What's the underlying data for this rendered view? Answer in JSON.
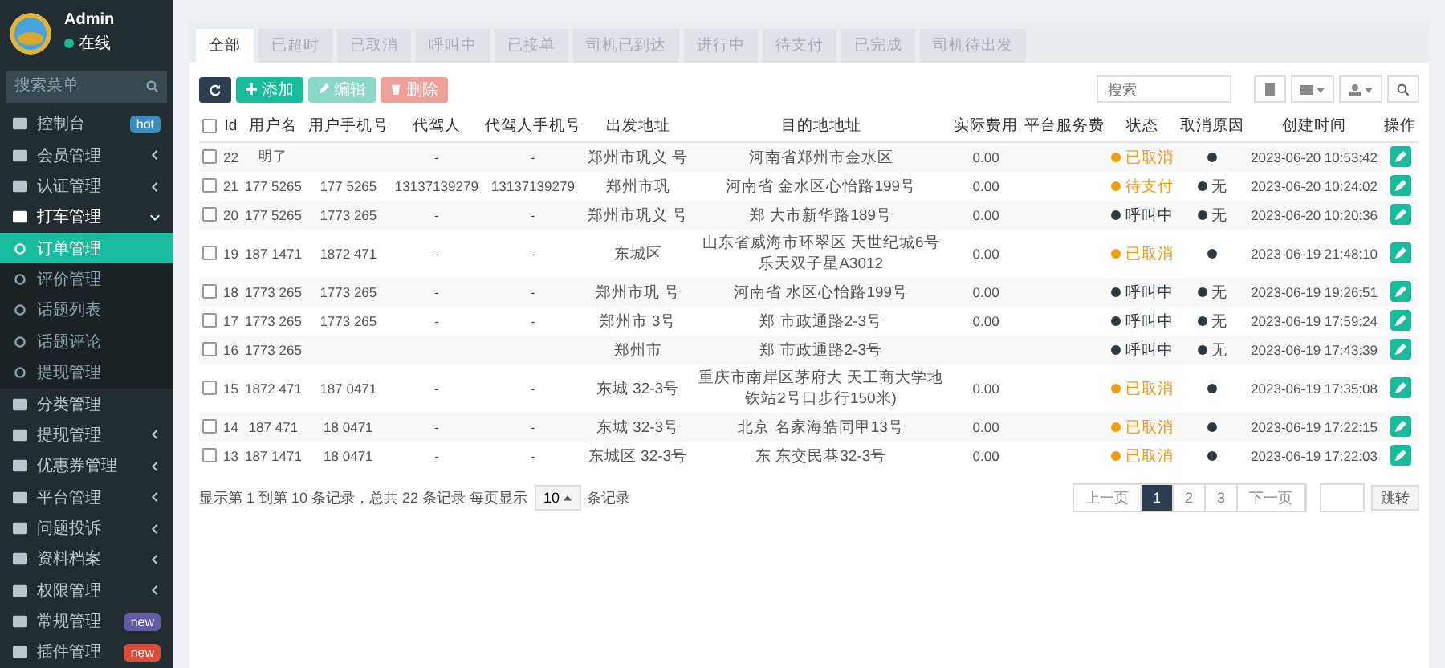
{
  "user": {
    "name": "Admin",
    "status": "在线"
  },
  "menu_search": {
    "placeholder": "搜索菜单"
  },
  "sidebar": {
    "items": [
      {
        "label": "控制台",
        "badge": {
          "text": "hot",
          "color": "#3c8dbc"
        },
        "selected": false
      },
      {
        "label": "会员管理",
        "expanded": false,
        "selected": false
      },
      {
        "label": "认证管理",
        "expanded": false,
        "selected": false
      },
      {
        "label": "打车管理",
        "expanded": true,
        "selected": false,
        "children": [
          {
            "label": "订单管理",
            "selected": true
          },
          {
            "label": "评价管理",
            "selected": false
          },
          {
            "label": "话题列表",
            "selected": false
          },
          {
            "label": "话题评论",
            "selected": false
          },
          {
            "label": "提现管理",
            "selected": false
          }
        ]
      },
      {
        "label": "分类管理",
        "selected": false
      },
      {
        "label": "提现管理",
        "expanded": false,
        "selected": false
      },
      {
        "label": "优惠券管理",
        "expanded": false,
        "selected": false
      },
      {
        "label": "平台管理",
        "expanded": false,
        "selected": false
      },
      {
        "label": "问题投诉",
        "expanded": false,
        "selected": false
      },
      {
        "label": "资料档案",
        "expanded": false,
        "selected": false
      },
      {
        "label": "权限管理",
        "expanded": false,
        "selected": false
      },
      {
        "label": "常规管理",
        "badge": {
          "text": "new",
          "color": "#605ca8"
        },
        "selected": false
      },
      {
        "label": "插件管理",
        "badge": {
          "text": "new",
          "color": "#dd4b39"
        },
        "selected": false
      }
    ]
  },
  "tabs": [
    {
      "label": "全部",
      "selected": true
    },
    {
      "label": "已超时",
      "selected": false
    },
    {
      "label": "已取消",
      "selected": false
    },
    {
      "label": "呼叫中",
      "selected": false
    },
    {
      "label": "已接单",
      "selected": false
    },
    {
      "label": "司机已到达",
      "selected": false
    },
    {
      "label": "进行中",
      "selected": false
    },
    {
      "label": "待支付",
      "selected": false
    },
    {
      "label": "已完成",
      "selected": false
    },
    {
      "label": "司机待出发",
      "selected": false
    }
  ],
  "toolbar": {
    "add": "添加",
    "edit": "编辑",
    "delete": "删除",
    "search": {
      "placeholder": "搜索"
    }
  },
  "table": {
    "header_checked": false,
    "columns": [
      "Id",
      "用户名",
      "用户手机号",
      "代驾人",
      "代驾人手机号",
      "出发地址",
      "目的地地址",
      "实际费用",
      "平台服务费",
      "状态",
      "取消原因",
      "创建时间",
      "操作"
    ],
    "rows": [
      {
        "checked": false,
        "id": "22",
        "user": "明了",
        "phone": "",
        "driver": "-",
        "driver_phone": "-",
        "from": "郑州市巩义 号",
        "to": "河南省郑州市金水区",
        "fee": "0.00",
        "status": {
          "text": "已取消",
          "color": "#f39c12"
        },
        "reason": "",
        "time": "2023-06-20 10:53:42"
      },
      {
        "checked": false,
        "id": "21",
        "user": "177 5265",
        "phone": "177 5265",
        "driver": "13137139279",
        "driver_phone": "13137139279",
        "from": "郑州市巩",
        "to": "河南省 金水区心怡路199号",
        "fee": "0.00",
        "status": {
          "text": "待支付",
          "color": "#f39c12"
        },
        "reason": "无",
        "time": "2023-06-20 10:24:02"
      },
      {
        "checked": false,
        "id": "20",
        "user": "177 5265",
        "phone": "1773 265",
        "driver": "-",
        "driver_phone": "-",
        "from": "郑州市巩义 号",
        "to": "郑 大市新华路189号",
        "fee": "0.00",
        "status": {
          "text": "呼叫中",
          "color": "#2c3b41"
        },
        "reason": "无",
        "time": "2023-06-20 10:20:36"
      },
      {
        "checked": false,
        "id": "19",
        "user": "187 1471",
        "phone": "1872 471",
        "driver": "-",
        "driver_phone": "-",
        "from": "东城区",
        "to": "山东省威海市环翠区 天世纪城6号乐天双子星A3012",
        "fee": "0.00",
        "status": {
          "text": "已取消",
          "color": "#f39c12"
        },
        "reason": "",
        "time": "2023-06-19 21:48:10"
      },
      {
        "checked": false,
        "id": "18",
        "user": "1773 265",
        "phone": "1773 265",
        "driver": "-",
        "driver_phone": "-",
        "from": "郑州市巩 号",
        "to": "河南省 水区心怡路199号",
        "fee": "0.00",
        "status": {
          "text": "呼叫中",
          "color": "#2c3b41"
        },
        "reason": "无",
        "time": "2023-06-19 19:26:51"
      },
      {
        "checked": false,
        "id": "17",
        "user": "1773 265",
        "phone": "1773 265",
        "driver": "-",
        "driver_phone": "-",
        "from": "郑州市 3号",
        "to": "郑 市政通路2-3号",
        "fee": "0.00",
        "status": {
          "text": "呼叫中",
          "color": "#2c3b41"
        },
        "reason": "无",
        "time": "2023-06-19 17:59:24"
      },
      {
        "checked": false,
        "id": "16",
        "user": "1773 265",
        "phone": "",
        "driver": "",
        "driver_phone": "",
        "from": "郑州市",
        "to": "郑 市政通路2-3号",
        "fee": "",
        "status": {
          "text": "呼叫中",
          "color": "#2c3b41"
        },
        "reason": "无",
        "time": "2023-06-19 17:43:39"
      },
      {
        "checked": false,
        "id": "15",
        "user": "1872 471",
        "phone": "187 0471",
        "driver": "-",
        "driver_phone": "-",
        "from": "东城 32-3号",
        "to": "重庆市南岸区茅府大 天工商大学地铁站2号口步行150米)",
        "fee": "0.00",
        "status": {
          "text": "已取消",
          "color": "#f39c12"
        },
        "reason": "",
        "time": "2023-06-19 17:35:08"
      },
      {
        "checked": false,
        "id": "14",
        "user": "187 471",
        "phone": "18 0471",
        "driver": "-",
        "driver_phone": "-",
        "from": "东城 32-3号",
        "to": "北京 名家海皓同甲13号",
        "fee": "0.00",
        "status": {
          "text": "已取消",
          "color": "#f39c12"
        },
        "reason": "",
        "time": "2023-06-19 17:22:15"
      },
      {
        "checked": false,
        "id": "13",
        "user": "187 1471",
        "phone": "18 0471",
        "driver": "-",
        "driver_phone": "-",
        "from": "东城区 32-3号",
        "to": "东 东交民巷32-3号",
        "fee": "0.00",
        "status": {
          "text": "已取消",
          "color": "#f39c12"
        },
        "reason": "",
        "time": "2023-06-19 17:22:03"
      }
    ]
  },
  "footer": {
    "summary": "显示第 1 到第 10 条记录，总共 22 条记录 每页显示",
    "page_size": "10",
    "suffix": "条记录"
  },
  "pagination": {
    "prev": "上一页",
    "pages": [
      {
        "label": "1",
        "selected": true
      },
      {
        "label": "2",
        "selected": false
      },
      {
        "label": "3",
        "selected": false
      }
    ],
    "next": "下一页",
    "jump": "跳转"
  }
}
